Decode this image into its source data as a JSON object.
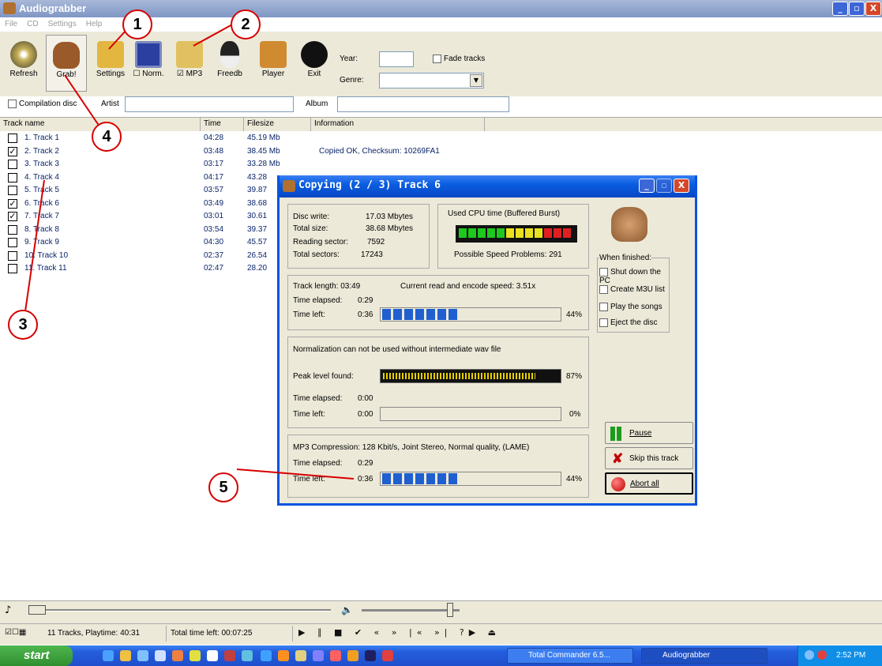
{
  "window": {
    "title": "Audiograbber",
    "minimize": "_",
    "maximize": "▫",
    "close": "X"
  },
  "menu": [
    "File",
    "CD",
    "Settings",
    "Help"
  ],
  "toolbar": {
    "buttons": [
      {
        "label": "Refresh",
        "icon": "cd-refresh-icon"
      },
      {
        "label": "Grab!",
        "icon": "grab-hand-icon"
      },
      {
        "label": "Settings",
        "icon": "settings-icon"
      },
      {
        "label": "Norm.",
        "icon": "normalize-monitor-icon"
      },
      {
        "label": "MP3",
        "icon": "mp3-encoder-icon"
      },
      {
        "label": "Freedb",
        "icon": "penguin-icon"
      },
      {
        "label": "Player",
        "icon": "player-icon"
      },
      {
        "label": "Exit",
        "icon": "exit-bomb-icon"
      }
    ],
    "norm_checked": "☐",
    "mp3_checked": "☑",
    "year_label": "Year:",
    "year_value": "",
    "genre_label": "Genre:",
    "genre_value": "",
    "fade_label": "Fade tracks"
  },
  "info_row": {
    "compilation_label": "Compilation disc",
    "artist_label": "Artist",
    "artist_value": "",
    "album_label": "Album",
    "album_value": ""
  },
  "columns": [
    "Track name",
    "Time",
    "Filesize",
    "Information"
  ],
  "tracks": [
    {
      "name": "1. Track  1",
      "time": "04:28",
      "size": "45.19 Mb",
      "info": "",
      "checked": false
    },
    {
      "name": "2. Track  2",
      "time": "03:48",
      "size": "38.45 Mb",
      "info": "Copied OK, Checksum: 10269FA1",
      "checked": true
    },
    {
      "name": "3. Track  3",
      "time": "03:17",
      "size": "33.28 Mb",
      "info": "",
      "checked": false
    },
    {
      "name": "4. Track  4",
      "time": "04:17",
      "size": "43.28",
      "info": "",
      "checked": false
    },
    {
      "name": "5. Track  5",
      "time": "03:57",
      "size": "39.87",
      "info": "",
      "checked": false
    },
    {
      "name": "6. Track  6",
      "time": "03:49",
      "size": "38.68",
      "info": "",
      "checked": true
    },
    {
      "name": "7. Track  7",
      "time": "03:01",
      "size": "30.61",
      "info": "",
      "checked": true
    },
    {
      "name": "8. Track  8",
      "time": "03:54",
      "size": "39.37",
      "info": "",
      "checked": false
    },
    {
      "name": "9. Track  9",
      "time": "04:30",
      "size": "45.57",
      "info": "",
      "checked": false
    },
    {
      "name": "10. Track 10",
      "time": "02:37",
      "size": "26.54",
      "info": "",
      "checked": false
    },
    {
      "name": "11. Track 11",
      "time": "02:47",
      "size": "28.20",
      "info": "",
      "checked": false
    }
  ],
  "dialog": {
    "title": "Copying  (2 / 3)  Track  6",
    "disc_write_label": "Disc write:",
    "disc_write_value": "17.03 Mbytes",
    "total_size_label": "Total size:",
    "total_size_value": "38.68 Mbytes",
    "reading_sector_label": "Reading sector:",
    "reading_sector_value": "7592",
    "total_sectors_label": "Total sectors:",
    "total_sectors_value": "17243",
    "cpu_label": "Used CPU time (Buffered Burst)",
    "speed_problems": "Possible Speed Problems: 291",
    "track_length": "Track length:  03:49",
    "speed": "Current read and encode speed: 3.51x",
    "time_elapsed_label": "Time elapsed:",
    "time_left_label": "Time left:",
    "read_elapsed": "0:29",
    "read_left": "0:36",
    "read_pct": "44%",
    "read_fraction": 0.44,
    "norm_note": "Normalization can not be used without intermediate wav file",
    "peak_label": "Peak level found:",
    "peak_pct": "87%",
    "peak_fraction": 0.87,
    "norm_elapsed": "0:00",
    "norm_left": "0:00",
    "norm_pct": "0%",
    "mp3_info": "MP3 Compression: 128 Kbit/s, Joint Stereo, Normal quality, (LAME)",
    "mp3_elapsed": "0:29",
    "mp3_left": "0:36",
    "mp3_pct": "44%",
    "mp3_fraction": 0.44,
    "when_finished": "When finished:",
    "options": [
      "Shut down the PC",
      "Create M3U list",
      "Play the songs",
      "Eject the disc"
    ],
    "pause": "Pause",
    "skip": "Skip this track",
    "abort": "Abort all"
  },
  "status": {
    "tracks": "11 Tracks,  Playtime: 40:31",
    "total_left": "Total time left: 00:07:25"
  },
  "taskbar": {
    "start": "start",
    "items": [
      "Total Commander 6.5...",
      "Audiograbber"
    ],
    "clock": "2:52 PM"
  },
  "annotations": [
    "1",
    "2",
    "3",
    "4",
    "5"
  ],
  "colors": {
    "accent_red": "#d60000",
    "title_blue": "#0a5ee0",
    "progress_blue": "#1f5fd0"
  }
}
